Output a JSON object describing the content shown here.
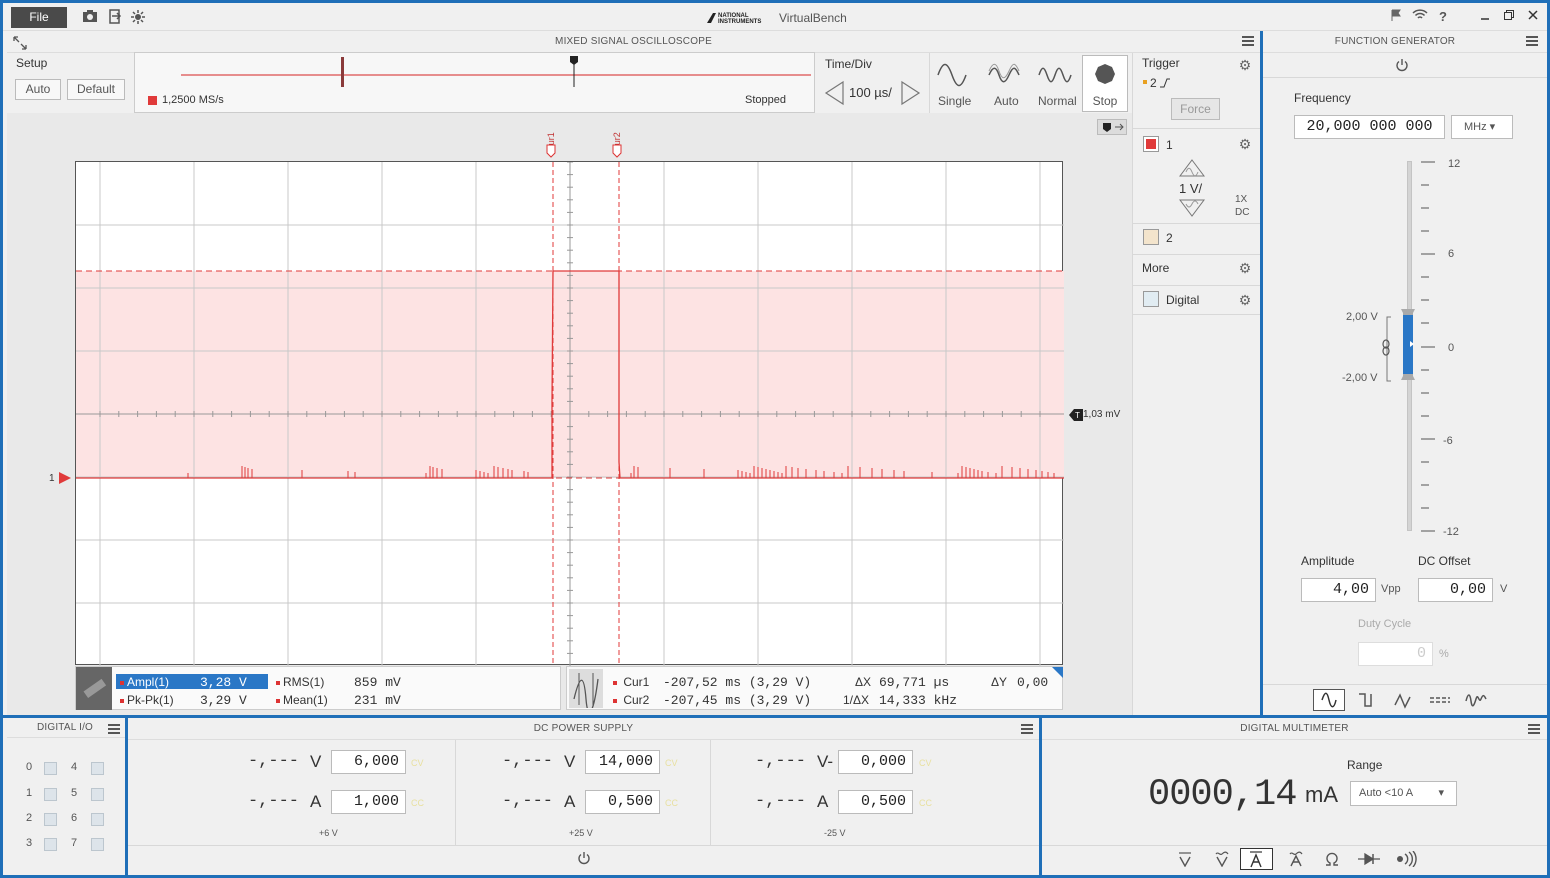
{
  "app": {
    "title": "VirtualBench",
    "brand": "NATIONAL INSTRUMENTS",
    "file_label": "File"
  },
  "scope": {
    "header": "MIXED SIGNAL OSCILLOSCOPE",
    "setup": {
      "label": "Setup",
      "auto": "Auto",
      "default": "Default"
    },
    "overview": {
      "sample_rate": "1,2500 MS/s",
      "status": "Stopped"
    },
    "timediv": {
      "label": "Time/Div",
      "value": "100 µs/"
    },
    "modes": {
      "single": "Single",
      "auto": "Auto",
      "normal": "Normal",
      "stop": "Stop"
    },
    "trigger": {
      "label": "Trigger",
      "source": "2",
      "force": "Force"
    },
    "channels": {
      "ch1": "1",
      "ch1_scale": "1 V/",
      "ch1_probe": "1X",
      "ch1_coupling": "DC",
      "ch2": "2",
      "more": "More",
      "digital": "Digital"
    },
    "cursors": {
      "cur1": "Cur1",
      "cur2": "Cur2"
    },
    "marker_level": "1,03 mV",
    "ch_marker": "1",
    "measurements": {
      "ampl_lbl": "Ampl(1)",
      "ampl_val": "3,28  V",
      "pkpk_lbl": "Pk-Pk(1)",
      "pkpk_val": "3,29  V",
      "rms_lbl": "RMS(1)",
      "rms_val": "859  mV",
      "mean_lbl": "Mean(1)",
      "mean_val": "231  mV"
    },
    "cursor_readout": {
      "cur1_lbl": "Cur1",
      "cur1_val": "-207,52 ms (3,29 V)",
      "cur2_lbl": "Cur2",
      "cur2_val": "-207,45 ms (3,29 V)",
      "dx_lbl": "ΔX",
      "dx_val": "69,771 µs",
      "inv_lbl": "1/ΔX",
      "inv_val": "14,333  kHz",
      "dy_lbl": "ΔY",
      "dy_val": "0,00"
    }
  },
  "fgen": {
    "header": "FUNCTION GENERATOR",
    "frequency_label": "Frequency",
    "frequency": "20,000 000 000",
    "freq_unit": "MHz",
    "scale": [
      "12",
      "6",
      "0",
      "-6",
      "-12"
    ],
    "high": "2,00 V",
    "low": "-2,00 V",
    "amplitude_label": "Amplitude",
    "amplitude": "4,00",
    "amp_unit": "Vpp",
    "offset_label": "DC Offset",
    "offset": "0,00",
    "offset_unit": "V",
    "duty_label": "Duty Cycle",
    "duty": "0",
    "duty_unit": "%"
  },
  "dio": {
    "header": "DIGITAL I/O",
    "lines": [
      "0",
      "1",
      "2",
      "3",
      "4",
      "5",
      "6",
      "7"
    ]
  },
  "psu": {
    "header": "DC POWER SUPPLY",
    "ch": [
      {
        "v_read": "-,---",
        "v_unit": "V",
        "v_set": "6,000",
        "cv": "CV",
        "a_read": "-,---",
        "a_unit": "A",
        "a_set": "1,000",
        "cc": "CC",
        "name": "+6 V"
      },
      {
        "v_read": "-,---",
        "v_unit": "V",
        "v_set": "14,000",
        "cv": "CV",
        "a_read": "-,---",
        "a_unit": "A",
        "a_set": "0,500",
        "cc": "CC",
        "name": "+25 V"
      },
      {
        "v_read": "-,---",
        "v_unit": "V-",
        "v_set": "0,000",
        "cv": "CV",
        "a_read": "-,---",
        "a_unit": "A",
        "a_set": "0,500",
        "cc": "CC",
        "name": "-25 V"
      }
    ]
  },
  "dmm": {
    "header": "DIGITAL MULTIMETER",
    "reading": "0000,14",
    "unit": "mA",
    "range_label": "Range",
    "range": "Auto <10 A"
  },
  "colors": {
    "ch1": "#e03a3a",
    "accent": "#1f6fb8",
    "shade": "#fde3e3"
  }
}
